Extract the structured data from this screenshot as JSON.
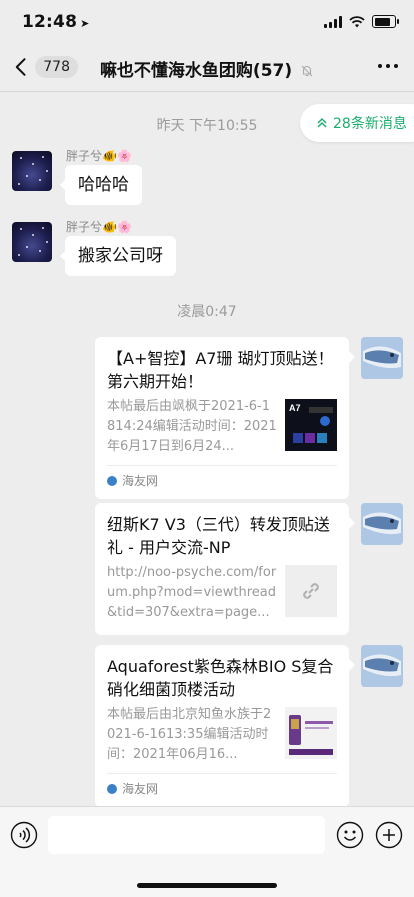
{
  "status": {
    "time": "12:48"
  },
  "nav": {
    "badge": "778",
    "title": "嘛也不懂海水鱼团购(57)"
  },
  "new_messages": "28条新消息",
  "timestamps": [
    "昨天 下午10:55",
    "凌晨0:47"
  ],
  "messages": [
    {
      "sender": "胖子兮🐠🌸",
      "text": "哈哈哈"
    },
    {
      "sender": "胖子兮🐠🌸",
      "text": "搬家公司呀"
    }
  ],
  "cards": [
    {
      "title": "【A+智控】A7珊 瑚灯顶贴送！第六期开始！",
      "desc": "本帖最后由飒枫于2021-6-1814:24编辑活动时间：2021年6月17日到6月24...",
      "source": "海友网",
      "thumb_text": "A7"
    },
    {
      "title": "纽斯K7 V3（三代）转发顶贴送礼 - 用户交流-NP",
      "desc": "http://noo-psyche.com/forum.php?mod=viewthread&tid=307&extra=page..."
    },
    {
      "title": "Aquaforest紫色森林BIO S复合硝化细菌顶楼活动",
      "desc": "本帖最后由北京知鱼水族于2021-6-1613:35编辑活动时间：2021年06月16...",
      "source": "海友网"
    }
  ]
}
